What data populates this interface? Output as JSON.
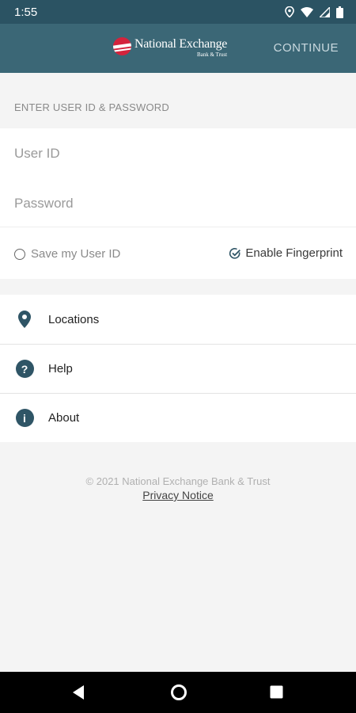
{
  "status_bar": {
    "time": "1:55",
    "icons": [
      "location-icon",
      "wifi-icon",
      "signal-icon",
      "battery-icon"
    ]
  },
  "app_bar": {
    "logo_name": "National Exchange",
    "logo_subtitle": "Bank & Trust",
    "continue_label": "CONTINUE",
    "background": "#3b6776"
  },
  "login": {
    "section_label": "ENTER USER ID & PASSWORD",
    "user_id_placeholder": "User ID",
    "password_placeholder": "Password",
    "save_user_id_label": "Save my User ID",
    "enable_fingerprint_label": "Enable Fingerprint"
  },
  "menu": {
    "items": [
      {
        "label": "Locations",
        "icon": "location-pin-icon"
      },
      {
        "label": "Help",
        "icon": "help-icon"
      },
      {
        "label": "About",
        "icon": "info-icon"
      }
    ]
  },
  "footer": {
    "copyright": "© 2021 National Exchange Bank & Trust",
    "privacy_link": "Privacy Notice"
  },
  "nav_bar": {
    "buttons": [
      "back-icon",
      "home-icon",
      "recents-icon"
    ]
  },
  "colors": {
    "primary": "#2f5566",
    "brand_red": "#d4233c"
  }
}
